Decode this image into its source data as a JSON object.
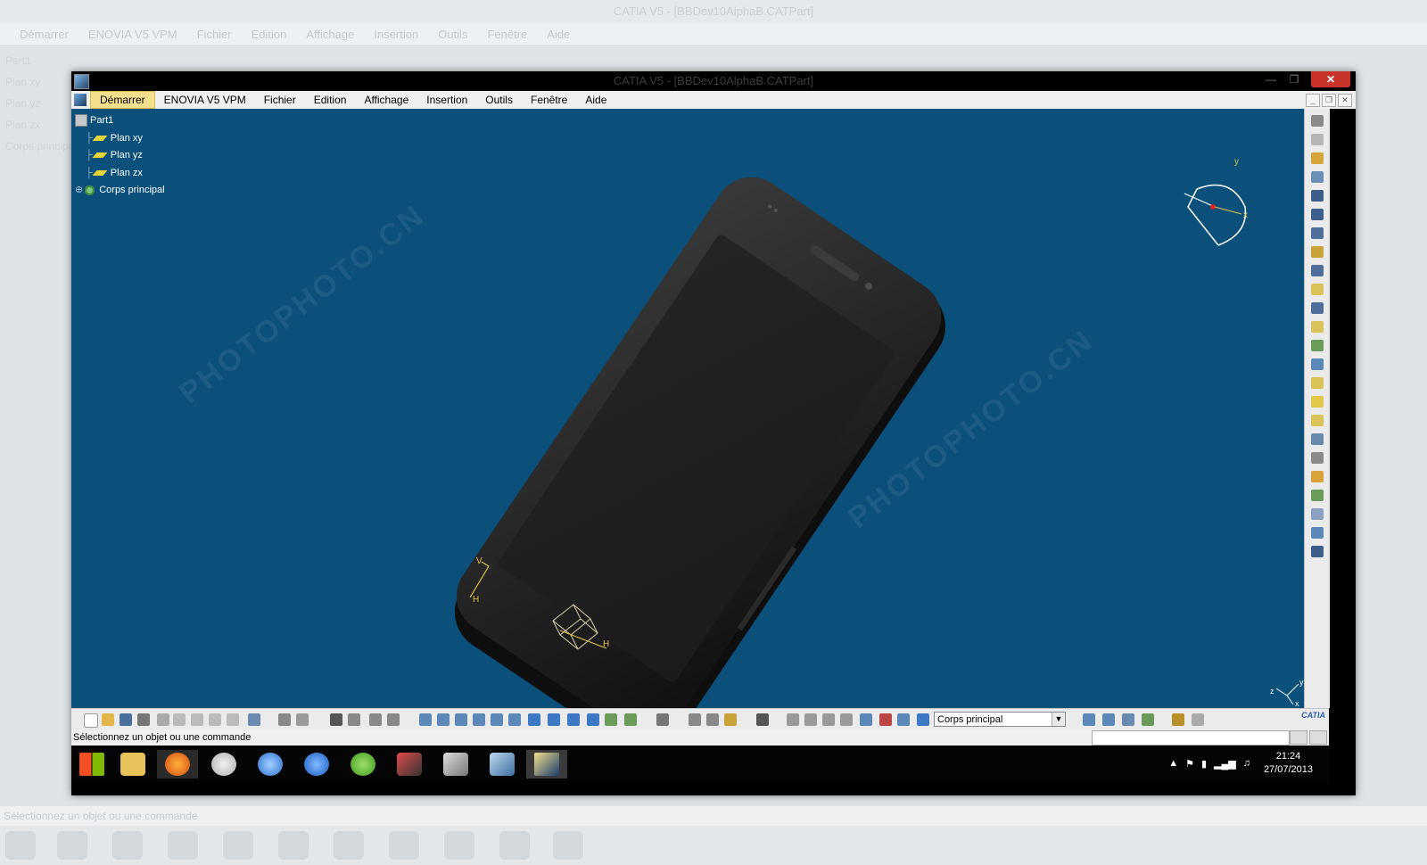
{
  "background": {
    "title": "CATIA V5 - [BBDev10AlphaB.CATPart]",
    "menu": [
      "Démarrer",
      "ENOVIA V5 VPM",
      "Fichier",
      "Edition",
      "Affichage",
      "Insertion",
      "Outils",
      "Fenêtre",
      "Aide"
    ],
    "tree": [
      "Part1",
      "Plan xy",
      "Plan yz",
      "Plan zx",
      "Corps principal"
    ],
    "status": "Sélectionnez un objet ou une commande"
  },
  "window": {
    "title": "CATIA V5 - [BBDev10AlphaB.CATPart]",
    "close_label": "✕",
    "minimize_label": "—",
    "maximize_label": "❐"
  },
  "menu": {
    "items": [
      "Démarrer",
      "ENOVIA V5 VPM",
      "Fichier",
      "Edition",
      "Affichage",
      "Insertion",
      "Outils",
      "Fenêtre",
      "Aide"
    ],
    "active": "Démarrer"
  },
  "tree": {
    "root": "Part1",
    "planes": [
      "Plan xy",
      "Plan yz",
      "Plan zx"
    ],
    "body": "Corps principal"
  },
  "viewport": {
    "background": "#0b4f7b",
    "model": "smartphone",
    "axis_labels": {
      "x": "x",
      "y": "y",
      "z": "z",
      "h": "H",
      "v": "V"
    },
    "watermark": "PHOTOPHOTO.CN"
  },
  "bottom_toolbar": {
    "current_body": "Corps principal",
    "logo_text": "CATIA"
  },
  "status": {
    "message": "Sélectionnez un objet ou une commande"
  },
  "taskbar": {
    "apps": [
      "windows-start",
      "file-explorer",
      "firefox",
      "paint",
      "itunes",
      "thunder",
      "utorrent",
      "creative-suite",
      "catia-tools",
      "3ds",
      "catia"
    ],
    "active_app": "catia",
    "time": "21:24",
    "date": "27/07/2013"
  },
  "colors": {
    "viewport": "#0b4f7b",
    "menu_active": "#f4e08c",
    "close": "#c9332b",
    "taskbar": "#050505",
    "plane_icon": "#e5d43a",
    "phone_body": "#1c1c1c"
  }
}
